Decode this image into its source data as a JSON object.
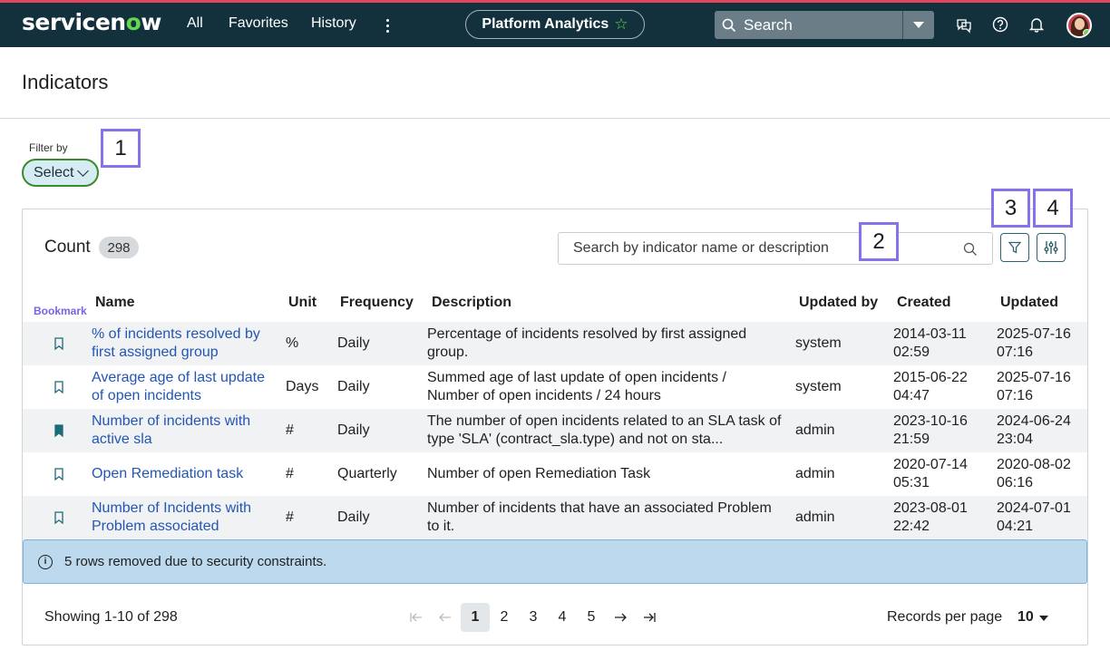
{
  "topbar": {
    "logo_main": "servicen",
    "logo_o": "o",
    "logo_end": "w",
    "nav": [
      "All",
      "Favorites",
      "History"
    ],
    "app_pill": "Platform Analytics",
    "search_placeholder": "Search",
    "icons": [
      "chat-icon",
      "help-icon",
      "bell-icon"
    ]
  },
  "page": {
    "title": "Indicators",
    "filter_label": "Filter by",
    "select_label": "Select"
  },
  "callouts": [
    "1",
    "2",
    "3",
    "4"
  ],
  "card": {
    "count_label": "Count",
    "count_value": "298",
    "search_placeholder": "Search by indicator name or description"
  },
  "table": {
    "bookmark_header": "Bookmark",
    "headers": [
      "Name",
      "Unit",
      "Frequency",
      "Description",
      "Updated by",
      "Created",
      "Updated"
    ],
    "rows": [
      {
        "bookmarked": false,
        "name": [
          "% of incidents resolved by",
          "first assigned group"
        ],
        "unit": "%",
        "frequency": "Daily",
        "description": [
          "Percentage of incidents resolved by first assigned",
          "group."
        ],
        "updated_by": "system",
        "created": [
          "2014-03-11",
          "02:59"
        ],
        "updated": [
          "2025-07-16",
          "07:16"
        ]
      },
      {
        "bookmarked": false,
        "name": [
          "Average age of last update",
          "of open incidents"
        ],
        "unit": "Days",
        "frequency": "Daily",
        "description": [
          "Summed age of last update of open incidents /",
          "Number of open incidents / 24 hours"
        ],
        "updated_by": "system",
        "created": [
          "2015-06-22",
          "04:47"
        ],
        "updated": [
          "2025-07-16",
          "07:16"
        ]
      },
      {
        "bookmarked": true,
        "name": [
          "Number of incidents with",
          "active sla"
        ],
        "unit": "#",
        "frequency": "Daily",
        "description": [
          "The number of open incidents related to an SLA task of",
          "type 'SLA' (contract_sla.type) and not on sta..."
        ],
        "updated_by": "admin",
        "created": [
          "2023-10-16",
          "21:59"
        ],
        "updated": [
          "2024-06-24",
          "23:04"
        ]
      },
      {
        "bookmarked": false,
        "name": [
          "Open Remediation task"
        ],
        "unit": "#",
        "frequency": "Quarterly",
        "description": [
          "Number of open Remediation Task"
        ],
        "updated_by": "admin",
        "created": [
          "2020-07-14",
          "05:31"
        ],
        "updated": [
          "2020-08-02",
          "06:16"
        ]
      },
      {
        "bookmarked": false,
        "name": [
          "Number of Incidents with",
          "Problem associated"
        ],
        "unit": "#",
        "frequency": "Daily",
        "description": [
          "Number of incidents that have an associated Problem",
          "to it."
        ],
        "updated_by": "admin",
        "created": [
          "2023-08-01",
          "22:42"
        ],
        "updated": [
          "2024-07-01",
          "04:21"
        ]
      }
    ]
  },
  "notice": "5 rows removed due to security constraints.",
  "footer": {
    "showing": "Showing 1-10 of 298",
    "pages": [
      "1",
      "2",
      "3",
      "4",
      "5"
    ],
    "active_page": "1",
    "records_label": "Records per page",
    "records_value": "10"
  },
  "colors": {
    "topbar": "#13303d",
    "accent_red": "#e2455c",
    "brand_green": "#62d84e",
    "link": "#2256b6",
    "callout": "#8a71ec",
    "notice_bg": "#bdd9ee"
  }
}
